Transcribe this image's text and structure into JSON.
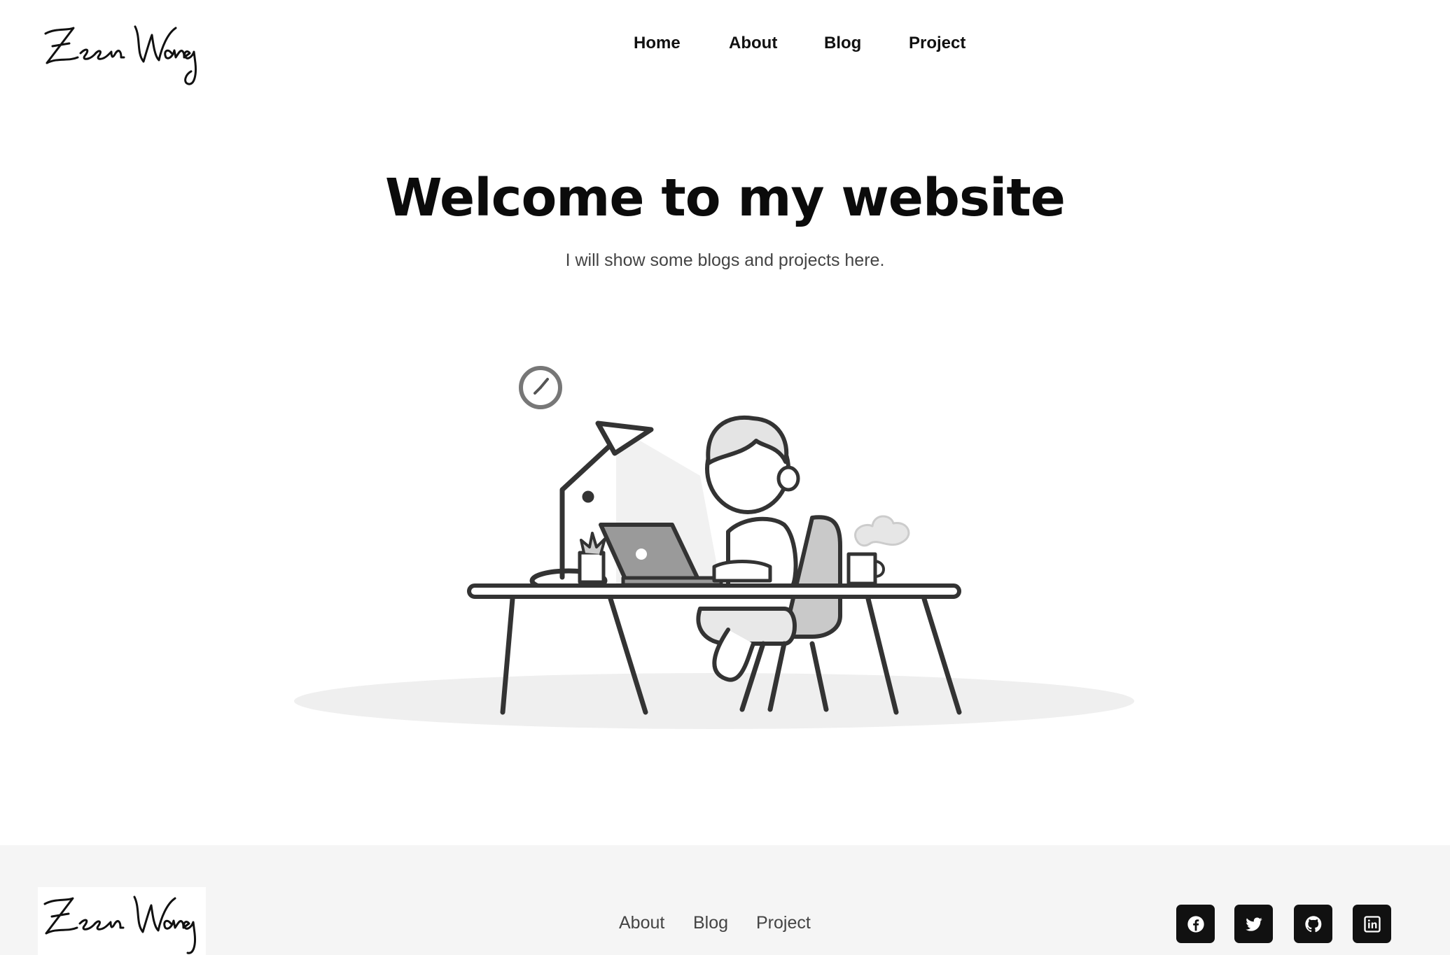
{
  "header": {
    "logo_text": "Zeen Wang",
    "nav": [
      "Home",
      "About",
      "Blog",
      "Project"
    ]
  },
  "hero": {
    "title": "Welcome to my website",
    "subtitle": "I will show some blogs and projects here."
  },
  "footer": {
    "logo_text": "Zeen Wang",
    "links": [
      "About",
      "Blog",
      "Project"
    ],
    "social": [
      {
        "icon": "facebook-icon"
      },
      {
        "icon": "twitter-icon"
      },
      {
        "icon": "github-icon"
      },
      {
        "icon": "linkedin-icon"
      }
    ]
  },
  "colors": {
    "background": "#ffffff",
    "text": "#111111",
    "footer_bg": "#f5f5f5",
    "social_bg": "#111111"
  }
}
